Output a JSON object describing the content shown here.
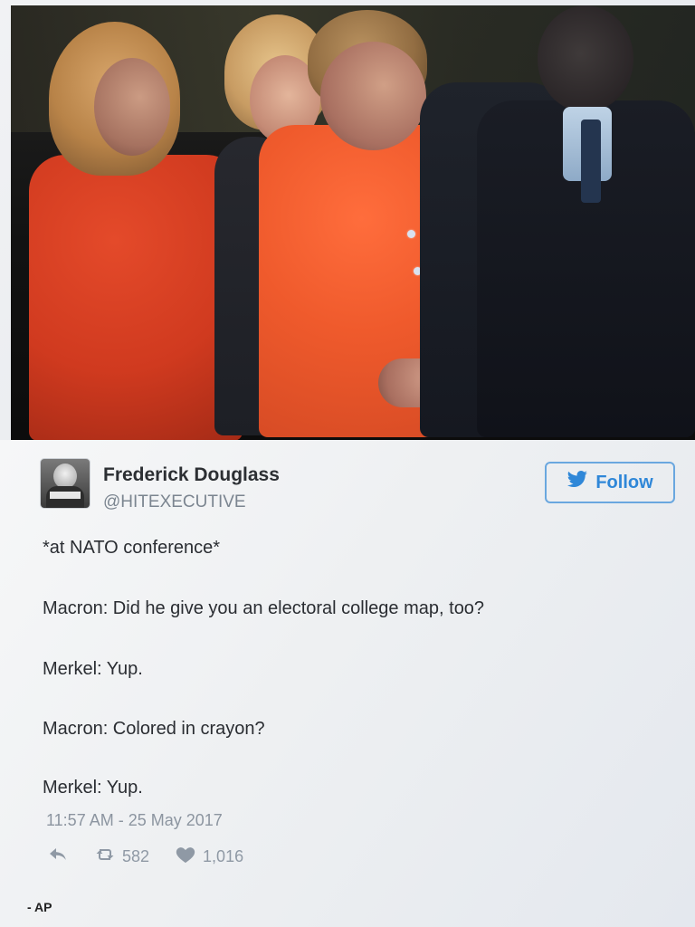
{
  "photo": {
    "alt": "Leaders at NATO conference"
  },
  "tweet": {
    "author_name": "Frederick Douglass",
    "author_handle": "@HITEXECUTIVE",
    "follow_label": "Follow",
    "lines": [
      "*at NATO conference*",
      "Macron: Did he give you an electoral college map, too?",
      "Merkel: Yup.",
      "Macron: Colored in crayon?",
      "Merkel: Yup."
    ],
    "timestamp": "11:57 AM - 25 May 2017",
    "retweets": "582",
    "likes": "1,016"
  },
  "credit": "- AP",
  "icons": {
    "follow": "bird-icon",
    "reply": "reply-icon",
    "retweet": "retweet-icon",
    "like": "heart-icon"
  },
  "colors": {
    "accent": "#2f87d8",
    "muted": "#8f99a5",
    "text": "#2a2d32",
    "orange": "#ef5a2c"
  }
}
